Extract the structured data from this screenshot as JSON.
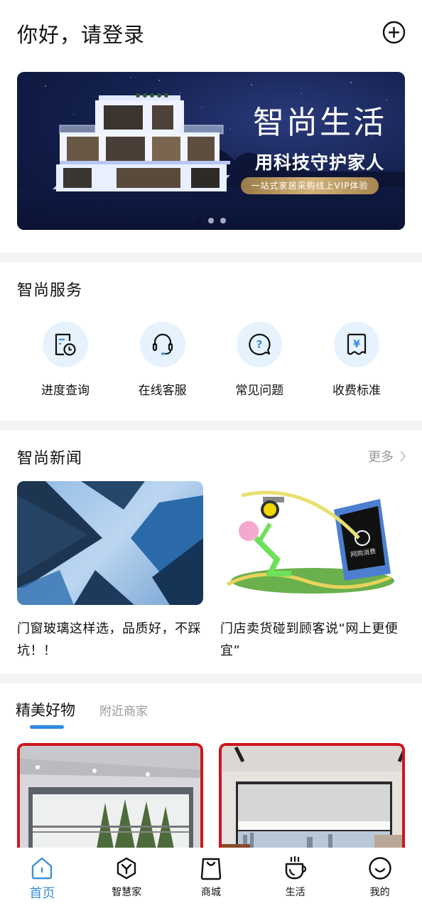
{
  "header": {
    "title": "你好，请登录",
    "add_icon": "circle-plus-icon"
  },
  "banner": {
    "headline": "智尚生活",
    "subline": "用科技守护家人",
    "pill_text": "一站式家居采购线上VIP体验",
    "slide_count": 3,
    "active_slide": 1
  },
  "services": {
    "title": "智尚服务",
    "items": [
      {
        "label": "进度查询",
        "icon": "schedule-document-icon"
      },
      {
        "label": "在线客服",
        "icon": "headset-icon"
      },
      {
        "label": "常见问题",
        "icon": "question-bubble-icon"
      },
      {
        "label": "收费标准",
        "icon": "yuan-receipt-icon"
      }
    ]
  },
  "news": {
    "title": "智尚新闻",
    "more_label": "更多",
    "items": [
      {
        "title": "门窗玻璃这样选，品质好，不踩坑！！",
        "image": "skyscrapers-photo"
      },
      {
        "title": "门店卖货碰到顾客说“网上更便宜”",
        "image": "online-shopping-cartoon",
        "image_caption": "网购消费"
      }
    ]
  },
  "products": {
    "tabs": [
      {
        "label": "精美好物",
        "active": true
      },
      {
        "label": "附近商家",
        "active": false
      }
    ],
    "items": [
      {
        "image": "window-forest-photo"
      },
      {
        "image": "window-city-view-photo"
      }
    ]
  },
  "tabbar": {
    "items": [
      {
        "label": "首页",
        "icon": "home-icon",
        "active": true
      },
      {
        "label": "智慧家",
        "icon": "hexagon-y-icon",
        "active": false
      },
      {
        "label": "商城",
        "icon": "shopping-bag-icon",
        "active": false
      },
      {
        "label": "生活",
        "icon": "coffee-cup-icon",
        "active": false
      },
      {
        "label": "我的",
        "icon": "smile-icon",
        "active": false
      }
    ]
  },
  "colors": {
    "accent": "#3b90d8",
    "tab_underline": "#2b8ae0",
    "service_circle": "#e6f2fd",
    "product_border": "#d0141d",
    "muted_text": "#999999",
    "separator": "#f4f4f4"
  }
}
